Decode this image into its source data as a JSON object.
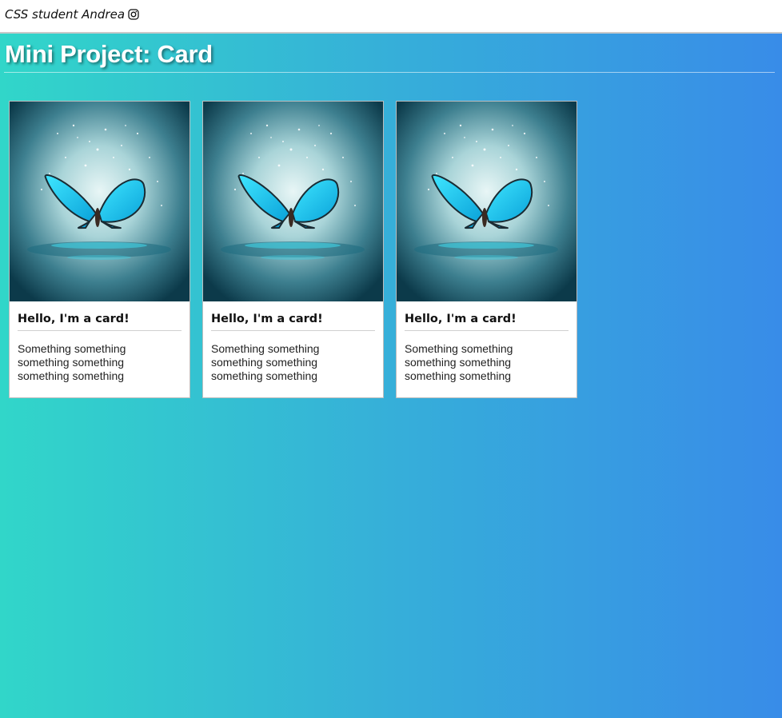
{
  "header": {
    "author_label": "CSS student Andrea",
    "social_icon": "instagram-icon"
  },
  "main": {
    "title": "Mini Project: Card"
  },
  "cards": [
    {
      "image": "butterfly-image",
      "title": "Hello, I'm a card!",
      "text": "Something something something something something something"
    },
    {
      "image": "butterfly-image",
      "title": "Hello, I'm a card!",
      "text": "Something something something something something something"
    },
    {
      "image": "butterfly-image",
      "title": "Hello, I'm a card!",
      "text": "Something something something something something something"
    }
  ],
  "colors": {
    "gradient_start": "#31d6c9",
    "gradient_end": "#388ce8",
    "card_background": "#ffffff"
  }
}
